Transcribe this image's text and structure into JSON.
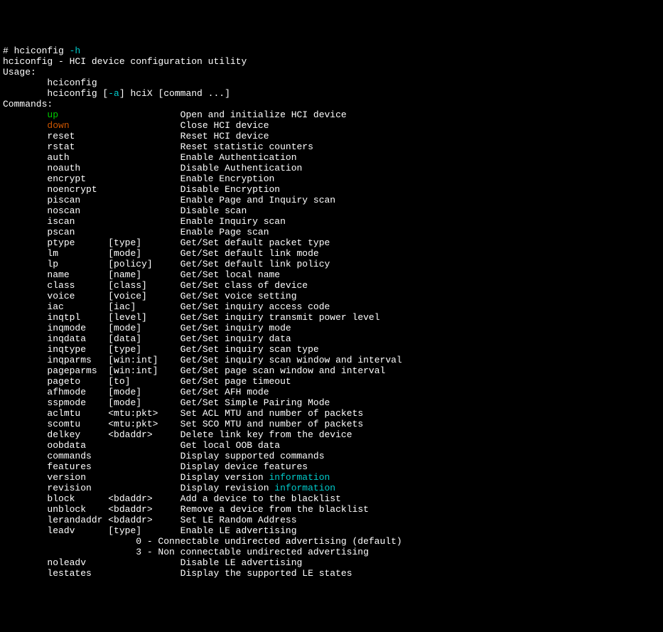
{
  "prompt": {
    "hash": "# ",
    "cmd": "hciconfig ",
    "flag": "-h"
  },
  "header": {
    "title": "hciconfig - HCI device configuration utility",
    "usage_label": "Usage:",
    "usage1": "        hciconfig",
    "usage2_pre": "        hciconfig [",
    "usage2_flag": "-a",
    "usage2_post": "] hciX [command ...]",
    "commands_label": "Commands:"
  },
  "commands": [
    {
      "cmd": "up",
      "arg": "",
      "desc": "Open and initialize HCI device",
      "class": "cmd-up"
    },
    {
      "cmd": "down",
      "arg": "",
      "desc": "Close HCI device",
      "class": "cmd-down"
    },
    {
      "cmd": "reset",
      "arg": "",
      "desc": "Reset HCI device",
      "class": ""
    },
    {
      "cmd": "rstat",
      "arg": "",
      "desc": "Reset statistic counters",
      "class": ""
    },
    {
      "cmd": "auth",
      "arg": "",
      "desc": "Enable Authentication",
      "class": ""
    },
    {
      "cmd": "noauth",
      "arg": "",
      "desc": "Disable Authentication",
      "class": ""
    },
    {
      "cmd": "encrypt",
      "arg": "",
      "desc": "Enable Encryption",
      "class": ""
    },
    {
      "cmd": "noencrypt",
      "arg": "",
      "desc": "Disable Encryption",
      "class": ""
    },
    {
      "cmd": "piscan",
      "arg": "",
      "desc": "Enable Page and Inquiry scan",
      "class": ""
    },
    {
      "cmd": "noscan",
      "arg": "",
      "desc": "Disable scan",
      "class": ""
    },
    {
      "cmd": "iscan",
      "arg": "",
      "desc": "Enable Inquiry scan",
      "class": ""
    },
    {
      "cmd": "pscan",
      "arg": "",
      "desc": "Enable Page scan",
      "class": ""
    },
    {
      "cmd": "ptype",
      "arg": "[type]",
      "desc": "Get/Set default packet type",
      "class": ""
    },
    {
      "cmd": "lm",
      "arg": "[mode]",
      "desc": "Get/Set default link mode",
      "class": ""
    },
    {
      "cmd": "lp",
      "arg": "[policy]",
      "desc": "Get/Set default link policy",
      "class": ""
    },
    {
      "cmd": "name",
      "arg": "[name]",
      "desc": "Get/Set local name",
      "class": ""
    },
    {
      "cmd": "class",
      "arg": "[class]",
      "desc": "Get/Set class of device",
      "class": ""
    },
    {
      "cmd": "voice",
      "arg": "[voice]",
      "desc": "Get/Set voice setting",
      "class": ""
    },
    {
      "cmd": "iac",
      "arg": "[iac]",
      "desc": "Get/Set inquiry access code",
      "class": ""
    },
    {
      "cmd": "inqtpl",
      "arg": "[level]",
      "desc": "Get/Set inquiry transmit power level",
      "class": ""
    },
    {
      "cmd": "inqmode",
      "arg": "[mode]",
      "desc": "Get/Set inquiry mode",
      "class": ""
    },
    {
      "cmd": "inqdata",
      "arg": "[data]",
      "desc": "Get/Set inquiry data",
      "class": ""
    },
    {
      "cmd": "inqtype",
      "arg": "[type]",
      "desc": "Get/Set inquiry scan type",
      "class": ""
    },
    {
      "cmd": "inqparms",
      "arg": "[win:int]",
      "desc": "Get/Set inquiry scan window and interval",
      "class": ""
    },
    {
      "cmd": "pageparms",
      "arg": "[win:int]",
      "desc": "Get/Set page scan window and interval",
      "class": ""
    },
    {
      "cmd": "pageto",
      "arg": "[to]",
      "desc": "Get/Set page timeout",
      "class": ""
    },
    {
      "cmd": "afhmode",
      "arg": "[mode]",
      "desc": "Get/Set AFH mode",
      "class": ""
    },
    {
      "cmd": "sspmode",
      "arg": "[mode]",
      "desc": "Get/Set Simple Pairing Mode",
      "class": ""
    },
    {
      "cmd": "aclmtu",
      "arg": "<mtu:pkt>",
      "desc": "Set ACL MTU and number of packets",
      "class": ""
    },
    {
      "cmd": "scomtu",
      "arg": "<mtu:pkt>",
      "desc": "Set SCO MTU and number of packets",
      "class": ""
    },
    {
      "cmd": "delkey",
      "arg": "<bdaddr>",
      "desc": "Delete link key from the device",
      "class": ""
    },
    {
      "cmd": "oobdata",
      "arg": "",
      "desc": "Get local OOB data",
      "class": ""
    },
    {
      "cmd": "commands",
      "arg": "",
      "desc": "Display supported commands",
      "class": ""
    },
    {
      "cmd": "features",
      "arg": "",
      "desc": "Display device features",
      "class": ""
    },
    {
      "cmd": "version",
      "arg": "",
      "desc": "Display version ",
      "class": "",
      "info": "information"
    },
    {
      "cmd": "revision",
      "arg": "",
      "desc": "Display revision ",
      "class": "",
      "info": "information"
    },
    {
      "cmd": "block",
      "arg": "<bdaddr>",
      "desc": "Add a device to the blacklist",
      "class": ""
    },
    {
      "cmd": "unblock",
      "arg": "<bdaddr>",
      "desc": "Remove a device from the blacklist",
      "class": ""
    },
    {
      "cmd": "lerandaddr",
      "arg": "<bdaddr>",
      "desc": "Set LE Random Address",
      "class": ""
    },
    {
      "cmd": "leadv",
      "arg": "[type]",
      "desc": "Enable LE advertising",
      "class": ""
    },
    {
      "cmd": "",
      "arg": "",
      "desc": "        0 - Connectable undirected advertising (default)",
      "class": "",
      "sub": true
    },
    {
      "cmd": "",
      "arg": "",
      "desc": "        3 - Non connectable undirected advertising",
      "class": "",
      "sub": true
    },
    {
      "cmd": "noleadv",
      "arg": "",
      "desc": "Disable LE advertising",
      "class": ""
    },
    {
      "cmd": "lestates",
      "arg": "",
      "desc": "Display the supported LE states",
      "class": ""
    }
  ]
}
